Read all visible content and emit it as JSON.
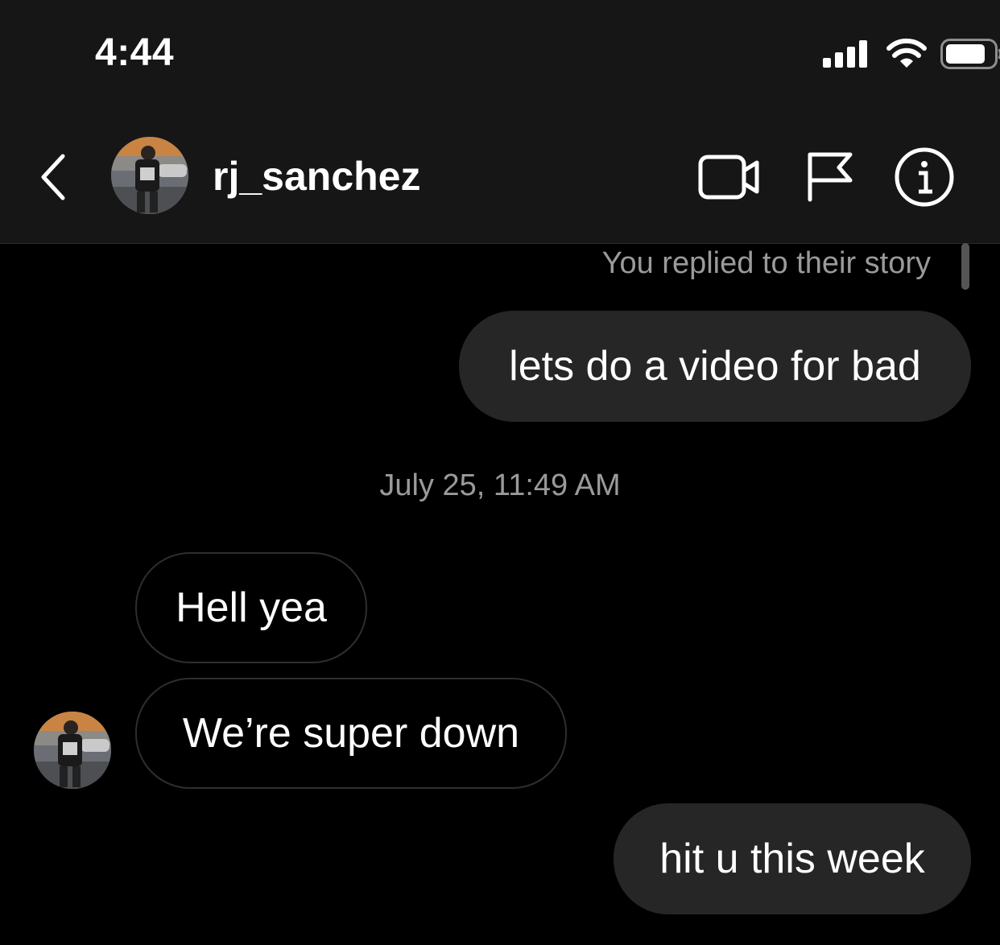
{
  "status_bar": {
    "time": "4:44",
    "signal_icon": "cellular-signal-icon",
    "wifi_icon": "wifi-icon",
    "battery_icon": "battery-icon"
  },
  "header": {
    "back_icon": "chevron-left-icon",
    "username": "rj_sanchez",
    "actions": [
      "video-call-icon",
      "flag-icon",
      "info-icon"
    ]
  },
  "thread": {
    "story_note": "You replied to their story",
    "timestamp": "July 25, 11:49 AM",
    "messages": [
      {
        "from": "me",
        "text": "lets do a video for bad"
      },
      {
        "from": "them",
        "text": "Hell yea"
      },
      {
        "from": "them",
        "text": "We’re super down"
      },
      {
        "from": "me",
        "text": "hit u this week"
      }
    ]
  },
  "colors": {
    "background": "#000000",
    "header_bg": "#161616",
    "sent_bubble": "#262626",
    "received_border": "#2e2e2e",
    "meta_text": "#9a9a9a"
  }
}
